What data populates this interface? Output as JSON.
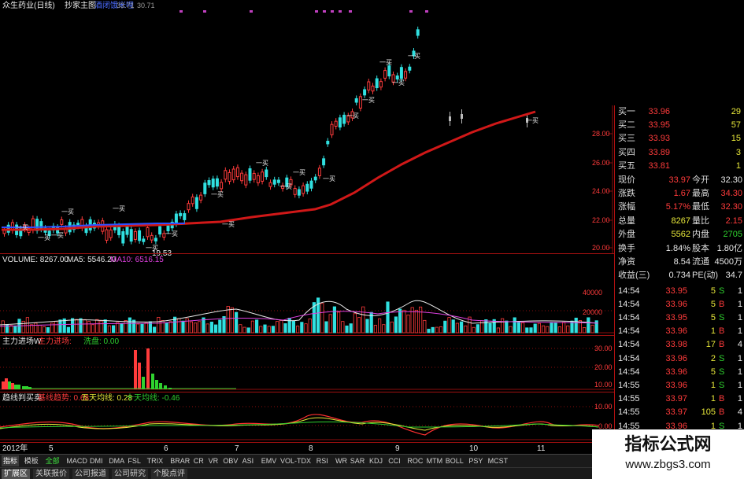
{
  "main": {
    "title": "众生药业(日线)",
    "indicator_name": "抄家主图",
    "badge": "酒闭饿米哩",
    "value1": "33.71",
    "value2": "30.71",
    "low_label": "19.53",
    "marker_label": "一买",
    "year_label": "2012年",
    "price_axis": [
      "28.00",
      "26.00",
      "24.00",
      "22.00",
      "20.00"
    ],
    "month_labels": [
      "5",
      "6",
      "7",
      "8",
      "9",
      "10",
      "11"
    ]
  },
  "volume": {
    "label": "VOLUME: 8267.00",
    "ma5": "MA5: 5546.20",
    "ma10": "MA10: 6516.15",
    "axis": [
      "40000",
      "20000"
    ]
  },
  "fund": {
    "title": "主力进场W",
    "label1": "主力进场: ",
    "label2": "洗盘: 0.00",
    "axis": [
      "30.00",
      "20.00",
      "10.00"
    ]
  },
  "trend": {
    "title": "趋线判买卖",
    "label1": "基线趋势: 0.68",
    "label2": "五天均线: 0.28",
    "label3": "十天均线: -0.46",
    "axis": [
      "10.00",
      "0.00"
    ]
  },
  "quote": {
    "orderbook": [
      {
        "name": "买一",
        "price": "33.96",
        "vol": "29"
      },
      {
        "name": "买二",
        "price": "33.95",
        "vol": "57"
      },
      {
        "name": "买三",
        "price": "33.93",
        "vol": "15"
      },
      {
        "name": "买四",
        "price": "33.89",
        "vol": "3"
      },
      {
        "name": "买五",
        "price": "33.81",
        "vol": "1"
      }
    ],
    "stats": [
      {
        "l1": "现价",
        "v1": "33.97",
        "l2": "今开",
        "v2": "32.30"
      },
      {
        "l1": "涨跌",
        "v1": "1.67",
        "l2": "最高",
        "v2": "34.30"
      },
      {
        "l1": "涨幅",
        "v1": "5.17%",
        "l2": "最低",
        "v2": "32.30"
      },
      {
        "l1": "总量",
        "v1": "8267",
        "l2": "量比",
        "v2": "2.15"
      },
      {
        "l1": "外盘",
        "v1": "5562",
        "l2": "内盘",
        "v2": "2705"
      }
    ],
    "fin": [
      {
        "l1": "换手",
        "v1": "1.84%",
        "l2": "股本",
        "v2": "1.80亿"
      },
      {
        "l1": "净资",
        "v1": "8.54",
        "l2": "流通",
        "v2": "4500万"
      },
      {
        "l1": "收益(三)",
        "v1": "0.734",
        "l2": "PE(动)",
        "v2": "34.7"
      }
    ],
    "ticks": [
      {
        "time": "14:54",
        "price": "33.95",
        "vol": "5",
        "dir": "S",
        "n": "1"
      },
      {
        "time": "14:54",
        "price": "33.96",
        "vol": "5",
        "dir": "B",
        "n": "1"
      },
      {
        "time": "14:54",
        "price": "33.95",
        "vol": "5",
        "dir": "S",
        "n": "1"
      },
      {
        "time": "14:54",
        "price": "33.96",
        "vol": "1",
        "dir": "B",
        "n": "1"
      },
      {
        "time": "14:54",
        "price": "33.98",
        "vol": "17",
        "dir": "B",
        "n": "4"
      },
      {
        "time": "14:54",
        "price": "33.96",
        "vol": "2",
        "dir": "S",
        "n": "1"
      },
      {
        "time": "14:54",
        "price": "33.96",
        "vol": "5",
        "dir": "S",
        "n": "1"
      },
      {
        "time": "14:55",
        "price": "33.96",
        "vol": "1",
        "dir": "S",
        "n": "1"
      },
      {
        "time": "14:55",
        "price": "33.97",
        "vol": "1",
        "dir": "B",
        "n": "1"
      },
      {
        "time": "14:55",
        "price": "33.97",
        "vol": "105",
        "dir": "B",
        "n": "4"
      },
      {
        "time": "14:55",
        "price": "33.96",
        "vol": "1",
        "dir": "S",
        "n": "1"
      }
    ]
  },
  "tabs1": [
    "指标",
    "模板",
    "全部",
    "MACD",
    "DMI",
    "DMA",
    "FSL",
    "TRIX",
    "BRAR",
    "CR",
    "VR",
    "OBV",
    "ASI",
    "EMV",
    "VOL-TDX",
    "RSI",
    "WR",
    "SAR",
    "KDJ",
    "CCI",
    "ROC",
    "MTM",
    "BOLL",
    "PSY",
    "MCST"
  ],
  "tabs2": [
    "扩展区",
    "关联报价",
    "公司报道",
    "公司研究",
    "个股点评"
  ],
  "watermark": {
    "line1": "指标公式网",
    "line2": "www.zbgs3.com"
  },
  "colors": {
    "up": "#ff3b3b",
    "down": "#30e0e0",
    "ma_line": "#d01818",
    "grid": "#a01010"
  }
}
